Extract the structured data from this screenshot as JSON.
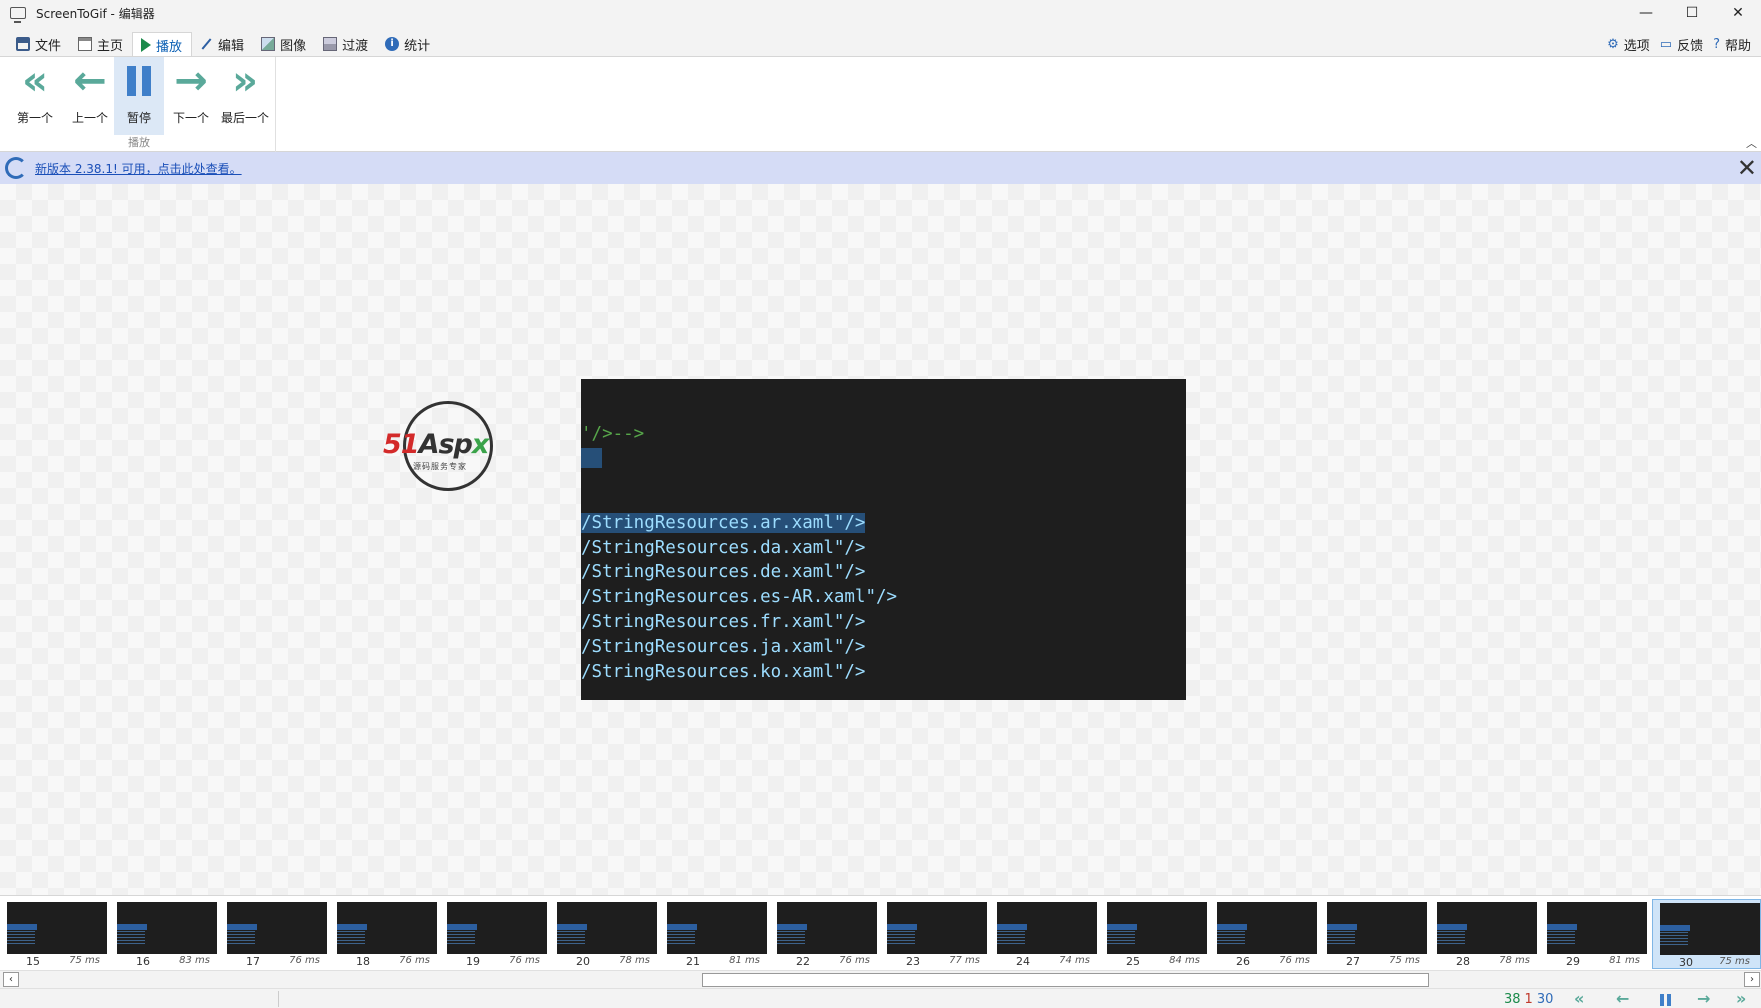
{
  "window": {
    "title": "ScreenToGif - 编辑器",
    "minimize": "—",
    "maximize": "☐",
    "close": "✕"
  },
  "menu": {
    "tabs": [
      {
        "label": "文件"
      },
      {
        "label": "主页"
      },
      {
        "label": "播放"
      },
      {
        "label": "编辑"
      },
      {
        "label": "图像"
      },
      {
        "label": "过渡"
      },
      {
        "label": "统计"
      }
    ],
    "options": "选项",
    "feedback": "反馈",
    "help": "帮助"
  },
  "ribbon": {
    "first": "第一个",
    "previous": "上一个",
    "pause": "暂停",
    "next": "下一个",
    "last": "最后一个",
    "group_label": "播放"
  },
  "notification": {
    "text": "新版本 2.38.1! 可用，点击此处查看。"
  },
  "logo": {
    "b1": "51",
    "b2": "Asp",
    "b3": "x",
    "tagline": "源码服务专家"
  },
  "frame": {
    "comment_line": "'/>-->",
    "lines": [
      "/StringResources.ar.xaml\"/>",
      "/StringResources.da.xaml\"/>",
      "/StringResources.de.xaml\"/>",
      "/StringResources.es-AR.xaml\"/>",
      "/StringResources.fr.xaml\"/>",
      "/StringResources.ja.xaml\"/>",
      "/StringResources.ko.xaml\"/>"
    ]
  },
  "thumbnails": [
    {
      "num": "15",
      "ms": "75 ms"
    },
    {
      "num": "16",
      "ms": "83 ms"
    },
    {
      "num": "17",
      "ms": "76 ms"
    },
    {
      "num": "18",
      "ms": "76 ms"
    },
    {
      "num": "19",
      "ms": "76 ms"
    },
    {
      "num": "20",
      "ms": "78 ms"
    },
    {
      "num": "21",
      "ms": "81 ms"
    },
    {
      "num": "22",
      "ms": "76 ms"
    },
    {
      "num": "23",
      "ms": "77 ms"
    },
    {
      "num": "24",
      "ms": "74 ms"
    },
    {
      "num": "25",
      "ms": "84 ms"
    },
    {
      "num": "26",
      "ms": "76 ms"
    },
    {
      "num": "27",
      "ms": "75 ms"
    },
    {
      "num": "28",
      "ms": "78 ms"
    },
    {
      "num": "29",
      "ms": "81 ms"
    },
    {
      "num": "30",
      "ms": "75 ms"
    }
  ],
  "status": {
    "total": "38",
    "selected": "1",
    "current": "30"
  }
}
